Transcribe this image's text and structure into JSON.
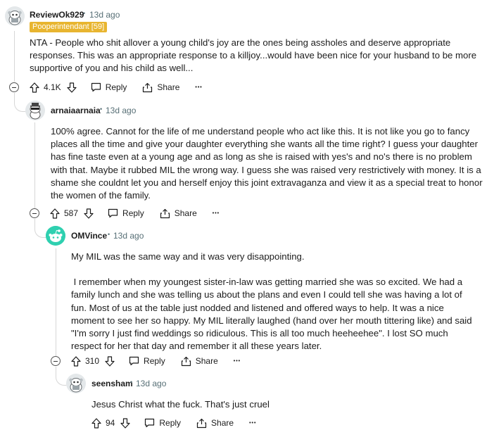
{
  "comments": [
    {
      "user": "ReviewOk929",
      "time": "13d ago",
      "flair": "Pooperintendant [59]",
      "body": "NTA - People who shit allover a young child's joy are the ones being assholes and deserve appropriate responses. This was an appropriate response to a killjoy...would have been nice for your husband to be more supportive of you and his child as well...",
      "score": "4.1K",
      "reply": "Reply",
      "share": "Share",
      "more": "•••"
    },
    {
      "user": "arnaiaarnaia",
      "time": "13d ago",
      "body": "100% agree. Cannot for the life of me understand people who act like this. It is not like you go to fancy places all the time and give your daughter everything she wants all the time right? I guess your daughter has fine taste even at a young age and as long as she is raised with yes's and no's there is no problem with that. Maybe it rubbed MIL the wrong way. I guess she was raised very restrictively with money. It is a shame she couldnt let you and herself enjoy this joint extravaganza and view it as a special treat to honor the women of the family.",
      "score": "587",
      "reply": "Reply",
      "share": "Share",
      "more": "•••"
    },
    {
      "user": "OMVince",
      "time": "13d ago",
      "body_p1": "My MIL was the same way and it was very disappointing.",
      "body_p2": " I remember when my youngest sister-in-law was getting married she was so excited. We had a family lunch and she was telling us about the plans and even I could tell she was having a lot of fun. Most of us at the table just nodded and listened and offered ways to help. It was a nice moment to see her so happy. My MIL literally laughed (hand over her mouth tittering like) and said \"I'm sorry I just find weddings so ridiculous. This is all too much heeheehee\". I lost SO much respect for her that day and remember it all these years later.",
      "score": "310",
      "reply": "Reply",
      "share": "Share",
      "more": "•••"
    },
    {
      "user": "seensham",
      "time": "13d ago",
      "body": "Jesus Christ what the fuck. That's just cruel",
      "score": "94",
      "reply": "Reply",
      "share": "Share",
      "more": "•••"
    }
  ],
  "separator": "•",
  "colors": {
    "flair_bg": "#e8b530",
    "omvince_avatar": "#2fd0b0",
    "meta": "#576f76"
  }
}
